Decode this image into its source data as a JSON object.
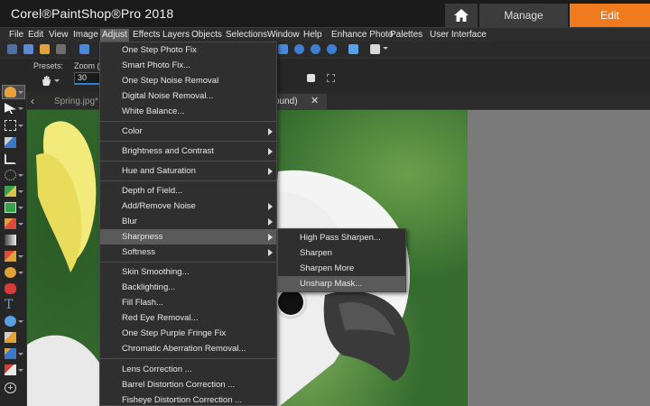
{
  "app": {
    "title": "Corel®PaintShop®Pro 2018"
  },
  "workspace_tabs": {
    "manage": "Manage",
    "edit": "Edit"
  },
  "menubar": {
    "items": [
      "File",
      "Edit",
      "View",
      "Image",
      "Adjust",
      "Effects",
      "Layers",
      "Objects",
      "Selections",
      "Window",
      "Help",
      "Enhance Photo",
      "Palettes",
      "User Interface"
    ],
    "active": "Adjust"
  },
  "tool_options": {
    "presets_label": "Presets:",
    "zoom_label": "Zoom (",
    "zoom_value": "30"
  },
  "document_tabs": [
    {
      "label": "Spring.jpg* @",
      "active": false
    },
    {
      "label": "ound)",
      "active": true
    }
  ],
  "adjust_menu": {
    "items": [
      {
        "label": "One Step Photo Fix",
        "submenu": false
      },
      {
        "label": "Smart Photo Fix...",
        "submenu": false
      },
      {
        "label": "One Step Noise Removal",
        "submenu": false
      },
      {
        "label": "Digital Noise Removal...",
        "submenu": false
      },
      {
        "label": "White Balance...",
        "submenu": false
      },
      {
        "label": "Color",
        "submenu": true
      },
      {
        "label": "Brightness and Contrast",
        "submenu": true
      },
      {
        "label": "Hue and Saturation",
        "submenu": true
      },
      {
        "label": "Depth of Field...",
        "submenu": false
      },
      {
        "label": "Add/Remove Noise",
        "submenu": true
      },
      {
        "label": "Blur",
        "submenu": true
      },
      {
        "label": "Sharpness",
        "submenu": true,
        "highlighted": true
      },
      {
        "label": "Softness",
        "submenu": true
      },
      {
        "label": "Skin Smoothing...",
        "submenu": false
      },
      {
        "label": "Backlighting...",
        "submenu": false
      },
      {
        "label": "Fill Flash...",
        "submenu": false
      },
      {
        "label": "Red Eye Removal...",
        "submenu": false
      },
      {
        "label": "One Step Purple Fringe Fix",
        "submenu": false
      },
      {
        "label": "Chromatic Aberration Removal...",
        "submenu": false
      },
      {
        "label": "Lens Correction ...",
        "submenu": false
      },
      {
        "label": "Barrel Distortion Correction ...",
        "submenu": false
      },
      {
        "label": "Fisheye Distortion Correction ...",
        "submenu": false
      }
    ]
  },
  "sharpness_submenu": {
    "items": [
      {
        "label": "High Pass Sharpen...",
        "highlighted": false
      },
      {
        "label": "Sharpen",
        "highlighted": false
      },
      {
        "label": "Sharpen More",
        "highlighted": false
      },
      {
        "label": "Unsharp Mask...",
        "highlighted": true
      }
    ]
  },
  "colors": {
    "accent_edit": "#f07a1e",
    "menu_bg": "#2f2f2f",
    "highlight": "#5a5a5a"
  }
}
